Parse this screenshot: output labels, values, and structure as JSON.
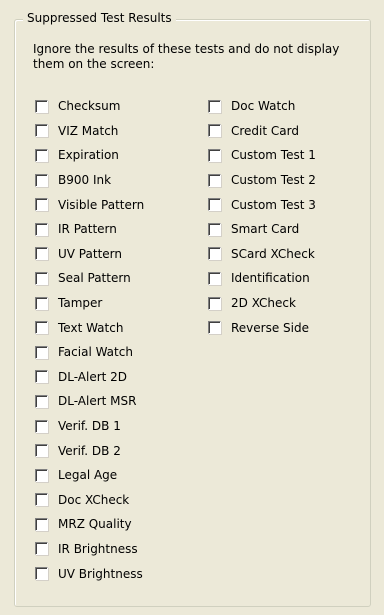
{
  "group": {
    "title": "Suppressed Test Results",
    "instructions": "Ignore the results of these tests and do not display them on the screen:"
  },
  "left_column": [
    {
      "label": "Checksum",
      "checked": false
    },
    {
      "label": "VIZ Match",
      "checked": false
    },
    {
      "label": "Expiration",
      "checked": false
    },
    {
      "label": "B900 Ink",
      "checked": false
    },
    {
      "label": "Visible Pattern",
      "checked": false
    },
    {
      "label": "IR Pattern",
      "checked": false
    },
    {
      "label": "UV Pattern",
      "checked": false
    },
    {
      "label": "Seal Pattern",
      "checked": false
    },
    {
      "label": "Tamper",
      "checked": false
    },
    {
      "label": "Text Watch",
      "checked": false
    },
    {
      "label": "Facial Watch",
      "checked": false
    },
    {
      "label": "DL-Alert 2D",
      "checked": false
    },
    {
      "label": "DL-Alert MSR",
      "checked": false
    },
    {
      "label": "Verif. DB 1",
      "checked": false
    },
    {
      "label": "Verif. DB 2",
      "checked": false
    },
    {
      "label": "Legal Age",
      "checked": false
    },
    {
      "label": "Doc XCheck",
      "checked": false
    },
    {
      "label": "MRZ Quality",
      "checked": false
    },
    {
      "label": "IR Brightness",
      "checked": false
    },
    {
      "label": "UV Brightness",
      "checked": false
    }
  ],
  "right_column": [
    {
      "label": "Doc Watch",
      "checked": false
    },
    {
      "label": "Credit Card",
      "checked": false
    },
    {
      "label": "Custom Test 1",
      "checked": false
    },
    {
      "label": "Custom Test 2",
      "checked": false
    },
    {
      "label": "Custom Test 3",
      "checked": false
    },
    {
      "label": "Smart Card",
      "checked": false
    },
    {
      "label": "SCard XCheck",
      "checked": false
    },
    {
      "label": "Identification",
      "checked": false
    },
    {
      "label": "2D XCheck",
      "checked": false
    },
    {
      "label": "Reverse Side",
      "checked": false
    }
  ]
}
